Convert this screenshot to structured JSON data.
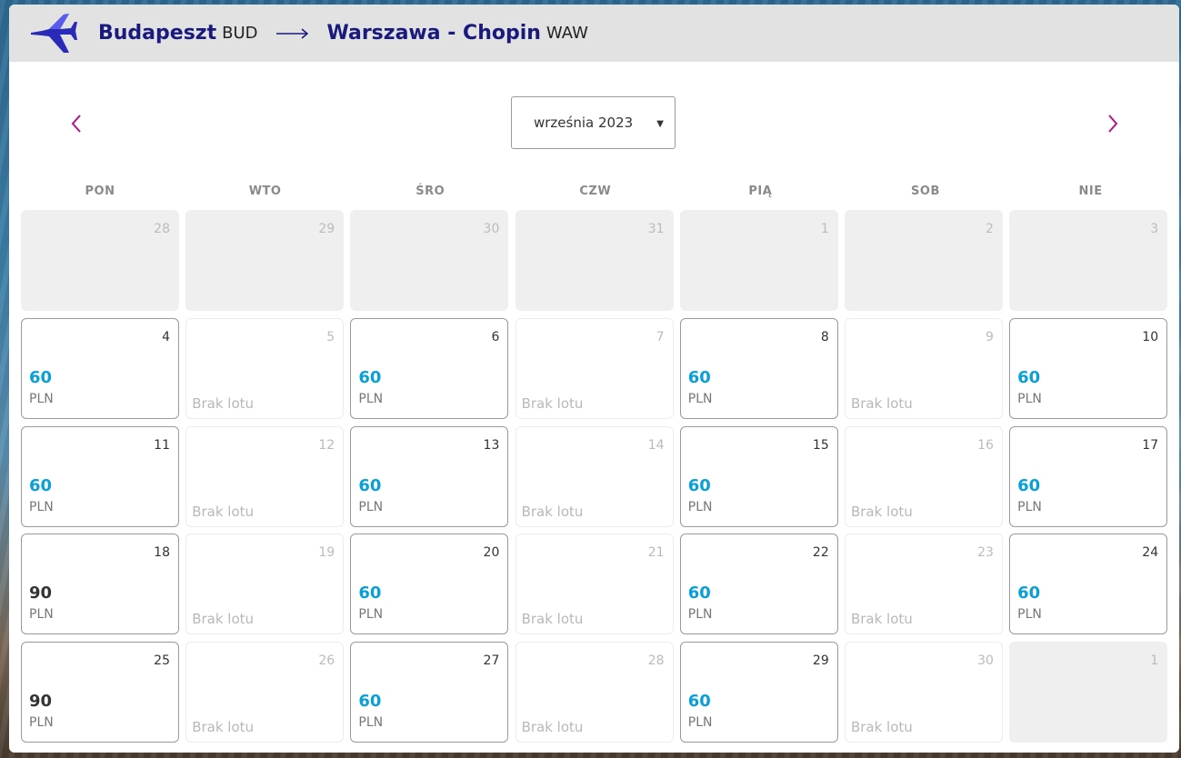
{
  "route": {
    "origin_city": "Budapeszt",
    "origin_code": "BUD",
    "dest_city": "Warszawa - Chopin",
    "dest_code": "WAW"
  },
  "calendar": {
    "month_label": "września 2023",
    "weekdays": [
      "PON",
      "WTO",
      "ŚRO",
      "CZW",
      "PIĄ",
      "SOB",
      "NIE"
    ],
    "currency": "PLN",
    "no_flight_label": "Brak lotu",
    "days": [
      {
        "day": "28",
        "state": "out"
      },
      {
        "day": "29",
        "state": "out"
      },
      {
        "day": "30",
        "state": "out"
      },
      {
        "day": "31",
        "state": "out"
      },
      {
        "day": "1",
        "state": "out"
      },
      {
        "day": "2",
        "state": "out"
      },
      {
        "day": "3",
        "state": "out"
      },
      {
        "day": "4",
        "state": "avail",
        "price": "60"
      },
      {
        "day": "5",
        "state": "none"
      },
      {
        "day": "6",
        "state": "avail",
        "price": "60"
      },
      {
        "day": "7",
        "state": "none"
      },
      {
        "day": "8",
        "state": "avail",
        "price": "60"
      },
      {
        "day": "9",
        "state": "none"
      },
      {
        "day": "10",
        "state": "avail",
        "price": "60"
      },
      {
        "day": "11",
        "state": "avail",
        "price": "60"
      },
      {
        "day": "12",
        "state": "none"
      },
      {
        "day": "13",
        "state": "avail",
        "price": "60"
      },
      {
        "day": "14",
        "state": "none"
      },
      {
        "day": "15",
        "state": "avail",
        "price": "60"
      },
      {
        "day": "16",
        "state": "none"
      },
      {
        "day": "17",
        "state": "avail",
        "price": "60"
      },
      {
        "day": "18",
        "state": "avail",
        "price": "90",
        "high": true
      },
      {
        "day": "19",
        "state": "none"
      },
      {
        "day": "20",
        "state": "avail",
        "price": "60"
      },
      {
        "day": "21",
        "state": "none"
      },
      {
        "day": "22",
        "state": "avail",
        "price": "60"
      },
      {
        "day": "23",
        "state": "none"
      },
      {
        "day": "24",
        "state": "avail",
        "price": "60"
      },
      {
        "day": "25",
        "state": "avail",
        "price": "90",
        "high": true
      },
      {
        "day": "26",
        "state": "none"
      },
      {
        "day": "27",
        "state": "avail",
        "price": "60"
      },
      {
        "day": "28",
        "state": "none"
      },
      {
        "day": "29",
        "state": "avail",
        "price": "60"
      },
      {
        "day": "30",
        "state": "none"
      },
      {
        "day": "1",
        "state": "out"
      }
    ]
  },
  "colors": {
    "brand": "#1a1a7e",
    "price": "#09a0d8",
    "nav_chevron": "#b0128a"
  },
  "icons": {
    "plane": "plane-icon",
    "arrow": "arrow-right-icon",
    "prev": "chevron-left-icon",
    "next": "chevron-right-icon",
    "caret": "caret-down-icon"
  }
}
